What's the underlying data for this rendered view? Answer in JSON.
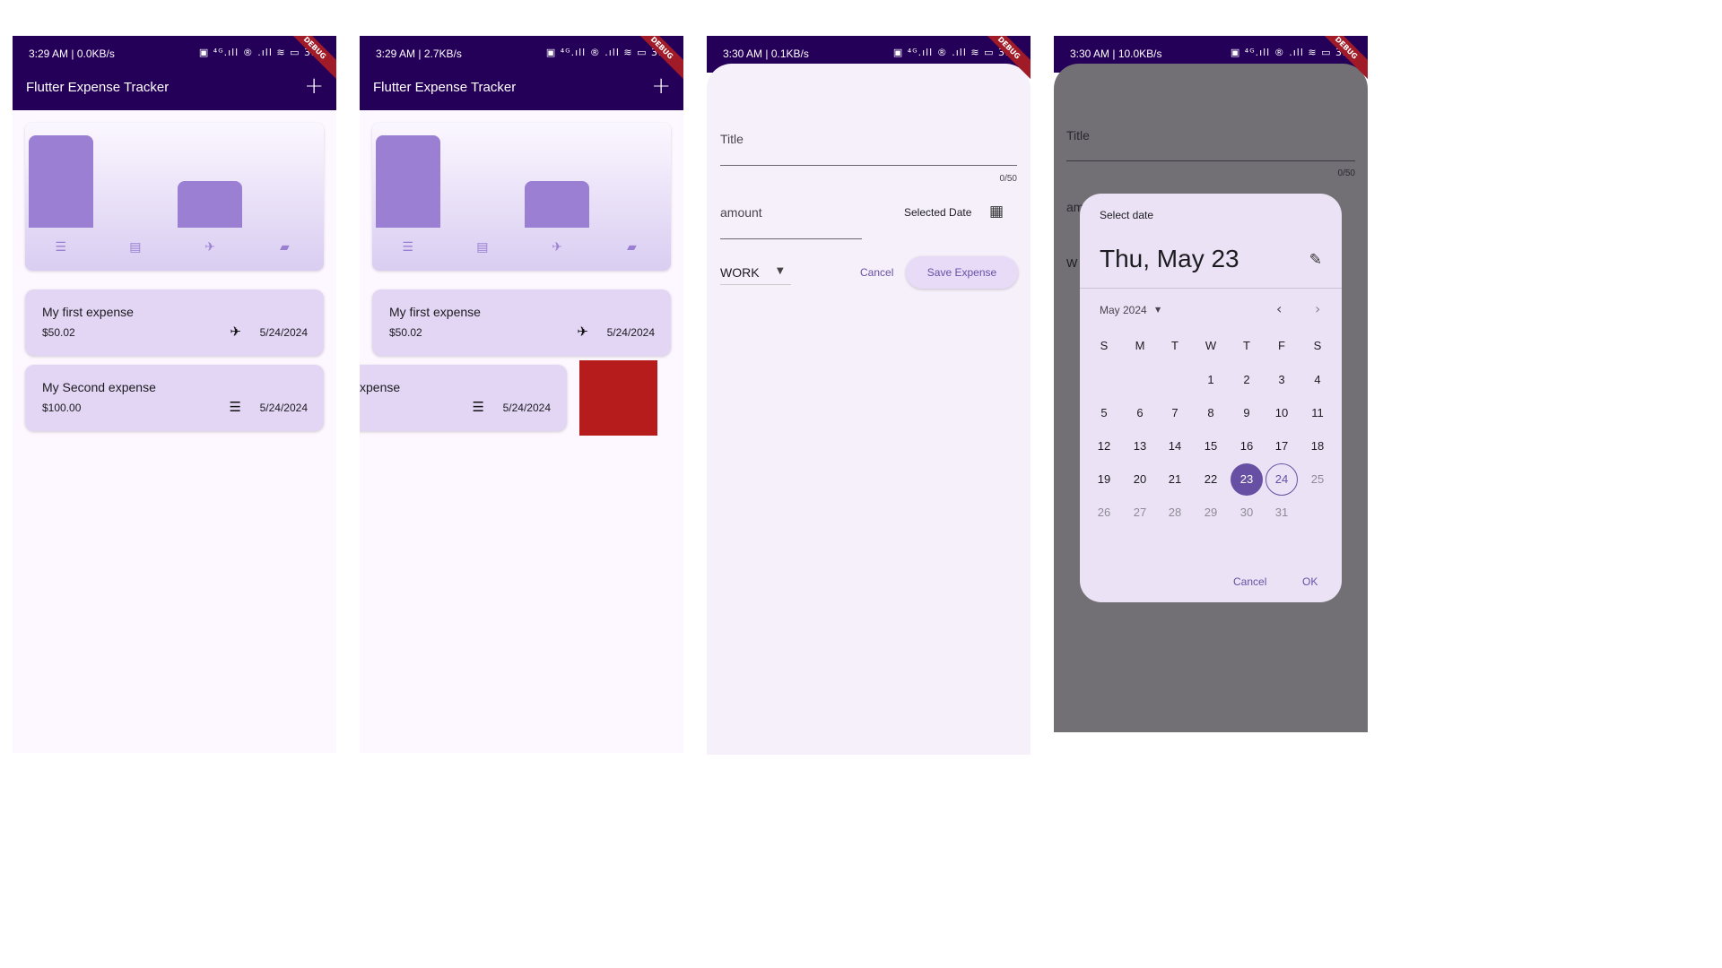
{
  "screens": [
    {
      "status_time": "3:29 AM | 0.0KB/s"
    },
    {
      "status_time": "3:29 AM | 2.7KB/s"
    },
    {
      "status_time": "3:30 AM | 0.1KB/s"
    },
    {
      "status_time": "3:30 AM | 10.0KB/s"
    }
  ],
  "status_icons": "▣ ⁴ᴳ.ıll ® .ıll ≋ ▭ 35",
  "debug_banner": "DEBUG",
  "app": {
    "title": "Flutter Expense Tracker",
    "add_icon": "plus-icon"
  },
  "chart_data": {
    "type": "bar",
    "categories": [
      "food",
      "leisure",
      "travel",
      "work"
    ],
    "values": [
      100.0,
      0,
      50.02,
      0
    ],
    "icons": [
      "hamburger-icon",
      "movie-icon",
      "flight-icon",
      "briefcase-icon"
    ]
  },
  "expenses": [
    {
      "title": "My first expense",
      "amount": "$50.02",
      "date": "5/24/2024",
      "icon": "flight-takeoff-icon"
    },
    {
      "title": "My Second expense",
      "amount": "$100.00",
      "date": "5/24/2024",
      "icon": "hamburger-icon"
    }
  ],
  "swiped_title": "xpense",
  "colors": {
    "appbar": "#250058",
    "bar": "#9a7fd2",
    "card": "#e2d6f4",
    "dismiss": "#b71c1c",
    "accent": "#6750a4"
  },
  "form": {
    "title_label": "Title",
    "counter": "0/50",
    "amount_label": "amount",
    "selected_date": "Selected Date",
    "category": "WORK",
    "cancel": "Cancel",
    "save": "Save Expense"
  },
  "picker": {
    "bg_title": "Title",
    "bg_counter": "0/50",
    "bg_amount_partial": "am",
    "bg_category_partial": "W",
    "header": "Select date",
    "selected": "Thu, May 23",
    "month": "May 2024",
    "weekdays": [
      "S",
      "M",
      "T",
      "W",
      "T",
      "F",
      "S"
    ],
    "cancel": "Cancel",
    "ok": "OK",
    "selected_day": 23,
    "today_day": 24
  }
}
